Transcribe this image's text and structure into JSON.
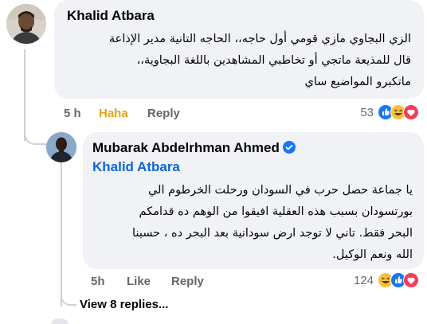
{
  "comment": {
    "author": "Khalid Atbara",
    "text_lines": [
      "الزي البجاوي مازي قومي أول حاجه،، الحاجه التانية مدير الإذاعة",
      "قال للمذيعة ماتجي أو تخاطبي المشاهدين باللغة البجاوية،،",
      "ماتكبرو المواضيع ساي"
    ],
    "time": "5 h",
    "reaction_label": "Haha",
    "reply_label": "Reply",
    "reaction_count": "53",
    "reaction_icons": [
      "like-reaction-icon",
      "haha-reaction-icon",
      "love-reaction-icon"
    ],
    "reaction_color": "#e2a50e"
  },
  "reply": {
    "author": "Mubarak Abdelrhman Ahmed",
    "verified": true,
    "mention": "Khalid Atbara",
    "text_lines": [
      "يا جماعة حصل حرب في السودان ورحلت الخرطوم الي",
      "بورتسودان بسبب هذه العقلية افيقوا من الوهم ده قدامكم",
      "البحر فقط. تاني لا توجد ارض سودانية بعد البحر ده ، حسبنا",
      "الله ونعم الوكيل."
    ],
    "time": "5h",
    "like_label": "Like",
    "reply_label": "Reply",
    "reaction_count": "124",
    "reaction_icons": [
      "haha-reaction-icon",
      "like-reaction-icon",
      "love-reaction-icon"
    ]
  },
  "view_replies_label": "View 8 replies...",
  "colors": {
    "bubble": "#f0f2f5",
    "mention": "#0b66d6",
    "muted": "#65676b",
    "verified": "#1877f2"
  }
}
